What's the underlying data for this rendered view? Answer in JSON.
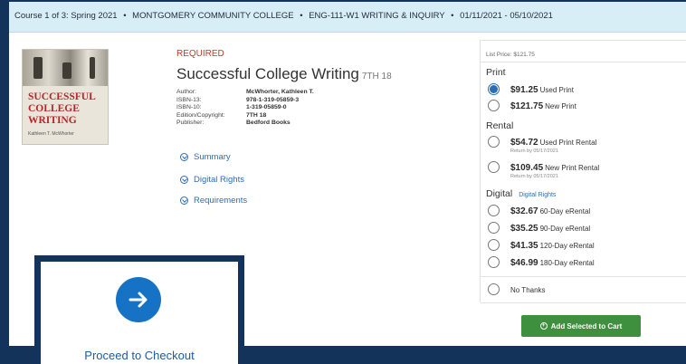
{
  "course_bar": {
    "course": "Course 1 of 3: Spring 2021",
    "college": "MONTGOMERY COMMUNITY COLLEGE",
    "section": "ENG-111-W1 WRITING & INQUIRY",
    "dates": "01/11/2021 - 05/10/2021",
    "separator": "•"
  },
  "book": {
    "cover_title_lines": [
      "SUCCESSFUL",
      "COLLEGE",
      "WRITING"
    ],
    "cover_author": "Kathleen T. McWhorter",
    "required_label": "REQUIRED",
    "title": "Successful College Writing",
    "edition_tag": "7TH 18",
    "details": [
      {
        "label": "Author:",
        "value": "McWhorter, Kathleen T."
      },
      {
        "label": "ISBN-13:",
        "value": "978-1-319-05859-3"
      },
      {
        "label": "ISBN-10:",
        "value": "1-319-05859-0"
      },
      {
        "label": "Edition/Copyright:",
        "value": "7TH 18"
      },
      {
        "label": "Publisher:",
        "value": "Bedford Books"
      }
    ],
    "expanders": [
      "Summary",
      "Digital Rights",
      "Requirements"
    ]
  },
  "pricing": {
    "list_price": "List Price: $121.75",
    "print_title": "Print",
    "print_options": [
      {
        "price": "$91.25",
        "desc": "Used Print",
        "selected": true
      },
      {
        "price": "$121.75",
        "desc": "New Print",
        "selected": false
      }
    ],
    "rental_title": "Rental",
    "rental_options": [
      {
        "price": "$54.72",
        "desc": "Used Print Rental",
        "note": "Return by 05/17/2021"
      },
      {
        "price": "$109.45",
        "desc": "New Print Rental",
        "note": "Return by 05/17/2021"
      }
    ],
    "digital_title": "Digital",
    "digital_rights_link": "Digital Rights",
    "digital_options": [
      {
        "price": "$32.67",
        "desc": "60-Day eRental"
      },
      {
        "price": "$35.25",
        "desc": "90-Day eRental"
      },
      {
        "price": "$41.35",
        "desc": "120-Day eRental"
      },
      {
        "price": "$46.99",
        "desc": "180-Day eRental"
      }
    ],
    "no_thanks": "No Thanks",
    "add_to_cart": "Add Selected to Cart"
  },
  "checkout": {
    "label": "Proceed to Checkout",
    "icon": "arrow-right-icon"
  },
  "colors": {
    "accent_blue": "#1672c4",
    "navy": "#13335b",
    "cart_green": "#3e8f3e",
    "required_red": "#c0392b"
  }
}
